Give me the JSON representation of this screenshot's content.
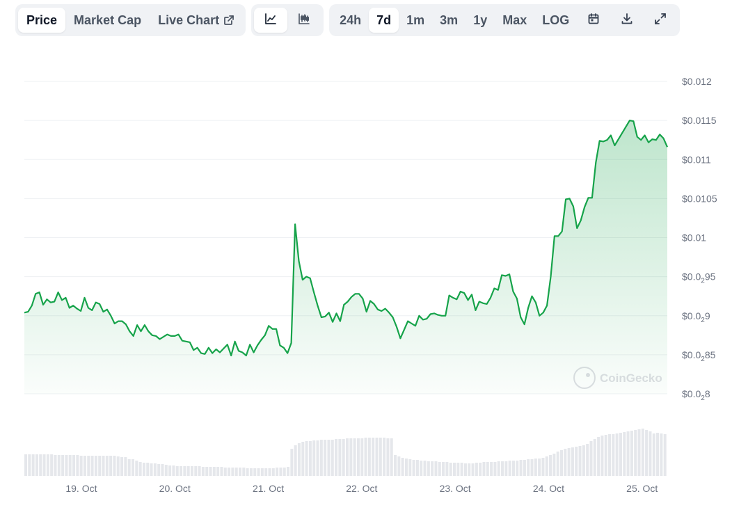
{
  "toolbar": {
    "views": [
      {
        "label": "Price",
        "active": true
      },
      {
        "label": "Market Cap",
        "active": false
      },
      {
        "label": "Live Chart",
        "active": false
      }
    ],
    "chart_types": [
      {
        "icon": "line-chart-icon",
        "active": true
      },
      {
        "icon": "candlestick-chart-icon",
        "active": false
      }
    ],
    "ranges": [
      {
        "label": "24h",
        "active": false
      },
      {
        "label": "7d",
        "active": true
      },
      {
        "label": "1m",
        "active": false
      },
      {
        "label": "3m",
        "active": false
      },
      {
        "label": "1y",
        "active": false
      },
      {
        "label": "Max",
        "active": false
      },
      {
        "label": "LOG",
        "active": false
      }
    ],
    "actions": [
      "calendar-icon",
      "download-icon",
      "fullscreen-icon"
    ]
  },
  "watermark": "CoinGecko",
  "colors": {
    "line": "#16a34a",
    "volume": "#e5e7eb",
    "grid": "#eef0f3",
    "axis_text": "#6b7280"
  },
  "chart_data": {
    "type": "area",
    "title": "",
    "xlabel": "",
    "ylabel": "",
    "ylim": [
      0.0078,
      0.01215
    ],
    "x_ticks": [
      "19. Oct",
      "20. Oct",
      "21. Oct",
      "22. Oct",
      "23. Oct",
      "24. Oct",
      "25. Oct"
    ],
    "y_ticks": [
      {
        "value": 0.008,
        "prefix": "$0.0",
        "sub": "2",
        "suffix": "8"
      },
      {
        "value": 0.0085,
        "prefix": "$0.0",
        "sub": "2",
        "suffix": "85"
      },
      {
        "value": 0.009,
        "prefix": "$0.0",
        "sub": "2",
        "suffix": "9"
      },
      {
        "value": 0.0095,
        "prefix": "$0.0",
        "sub": "2",
        "suffix": "95"
      },
      {
        "value": 0.01,
        "prefix": "$0.01",
        "sub": "",
        "suffix": ""
      },
      {
        "value": 0.0105,
        "prefix": "$0.0105",
        "sub": "",
        "suffix": ""
      },
      {
        "value": 0.011,
        "prefix": "$0.011",
        "sub": "",
        "suffix": ""
      },
      {
        "value": 0.0115,
        "prefix": "$0.0115",
        "sub": "",
        "suffix": ""
      },
      {
        "value": 0.012,
        "prefix": "$0.012",
        "sub": "",
        "suffix": ""
      }
    ],
    "x_range_days": [
      0,
      6.88
    ],
    "series": [
      {
        "values": [
          0.00904,
          0.00905,
          0.00913,
          0.00928,
          0.0093,
          0.00914,
          0.00921,
          0.00917,
          0.00918,
          0.0093,
          0.0092,
          0.00923,
          0.0091,
          0.00913,
          0.00909,
          0.00906,
          0.00923,
          0.0091,
          0.00907,
          0.00917,
          0.00915,
          0.00905,
          0.00908,
          0.009,
          0.0089,
          0.00893,
          0.00893,
          0.00889,
          0.0088,
          0.00874,
          0.00888,
          0.0088,
          0.00888,
          0.0088,
          0.00875,
          0.00874,
          0.0087,
          0.00873,
          0.00876,
          0.00874,
          0.00874,
          0.00876,
          0.00868,
          0.00867,
          0.00866,
          0.00856,
          0.00859,
          0.00852,
          0.00851,
          0.00859,
          0.00852,
          0.00857,
          0.00853,
          0.00858,
          0.00863,
          0.00849,
          0.00867,
          0.00855,
          0.00853,
          0.00849,
          0.00863,
          0.00853,
          0.00862,
          0.00869,
          0.00875,
          0.00887,
          0.00883,
          0.00883,
          0.00862,
          0.00859,
          0.00852,
          0.00865,
          0.01017,
          0.0097,
          0.00946,
          0.0095,
          0.00948,
          0.0093,
          0.00913,
          0.00898,
          0.00899,
          0.00904,
          0.00892,
          0.00903,
          0.00893,
          0.00914,
          0.00918,
          0.00924,
          0.00928,
          0.00928,
          0.00922,
          0.00905,
          0.00919,
          0.00915,
          0.00908,
          0.00906,
          0.00909,
          0.00904,
          0.00898,
          0.00886,
          0.00871,
          0.00882,
          0.00893,
          0.0089,
          0.00887,
          0.009,
          0.00895,
          0.00896,
          0.00902,
          0.00903,
          0.00901,
          0.009,
          0.009,
          0.00926,
          0.00923,
          0.00921,
          0.00931,
          0.00929,
          0.0092,
          0.00927,
          0.00907,
          0.00918,
          0.00916,
          0.00915,
          0.00923,
          0.00935,
          0.00933,
          0.00952,
          0.00951,
          0.00953,
          0.00931,
          0.00922,
          0.00898,
          0.00889,
          0.0091,
          0.00925,
          0.00917,
          0.009,
          0.00904,
          0.00913,
          0.0095,
          0.01002,
          0.01002,
          0.01008,
          0.01049,
          0.0105,
          0.0104,
          0.01012,
          0.01022,
          0.01039,
          0.01051,
          0.01051,
          0.01096,
          0.01124,
          0.01123,
          0.01125,
          0.01131,
          0.01118,
          0.01126,
          0.01134,
          0.01142,
          0.0115,
          0.01149,
          0.01129,
          0.01125,
          0.01131,
          0.01122,
          0.01126,
          0.01125,
          0.01132,
          0.01127,
          0.01116
        ]
      }
    ],
    "volume": {
      "values": [
        31,
        31,
        31,
        31,
        31,
        31,
        31,
        31,
        30,
        30,
        30,
        30,
        30,
        30,
        30,
        29,
        29,
        29,
        29,
        29,
        29,
        29,
        29,
        29,
        29,
        28,
        27,
        27,
        24,
        24,
        22,
        20,
        19,
        19,
        18,
        18,
        17,
        17,
        16,
        15,
        15,
        14,
        14,
        14,
        14,
        14,
        14,
        14,
        13,
        13,
        13,
        13,
        13,
        13,
        12,
        12,
        12,
        12,
        12,
        12,
        11,
        11,
        11,
        11,
        11,
        11,
        11,
        11,
        12,
        12,
        12,
        13,
        39,
        44,
        47,
        49,
        50,
        50,
        51,
        51,
        52,
        52,
        52,
        52,
        53,
        53,
        53,
        54,
        54,
        54,
        54,
        54,
        55,
        55,
        55,
        55,
        55,
        55,
        54,
        54,
        30,
        28,
        26,
        25,
        24,
        23,
        23,
        22,
        22,
        21,
        21,
        21,
        20,
        20,
        20,
        19,
        19,
        19,
        19,
        18,
        18,
        18,
        19,
        19,
        20,
        20,
        20,
        20,
        21,
        21,
        21,
        22,
        22,
        22,
        23,
        23,
        24,
        24,
        25,
        25,
        26,
        28,
        30,
        32,
        35,
        37,
        39,
        40,
        41,
        42,
        43,
        44,
        46,
        50,
        53,
        56,
        58,
        59,
        60,
        60,
        61,
        62,
        63,
        64,
        65,
        66,
        67,
        68,
        66,
        64,
        61,
        62,
        61,
        60
      ]
    }
  }
}
